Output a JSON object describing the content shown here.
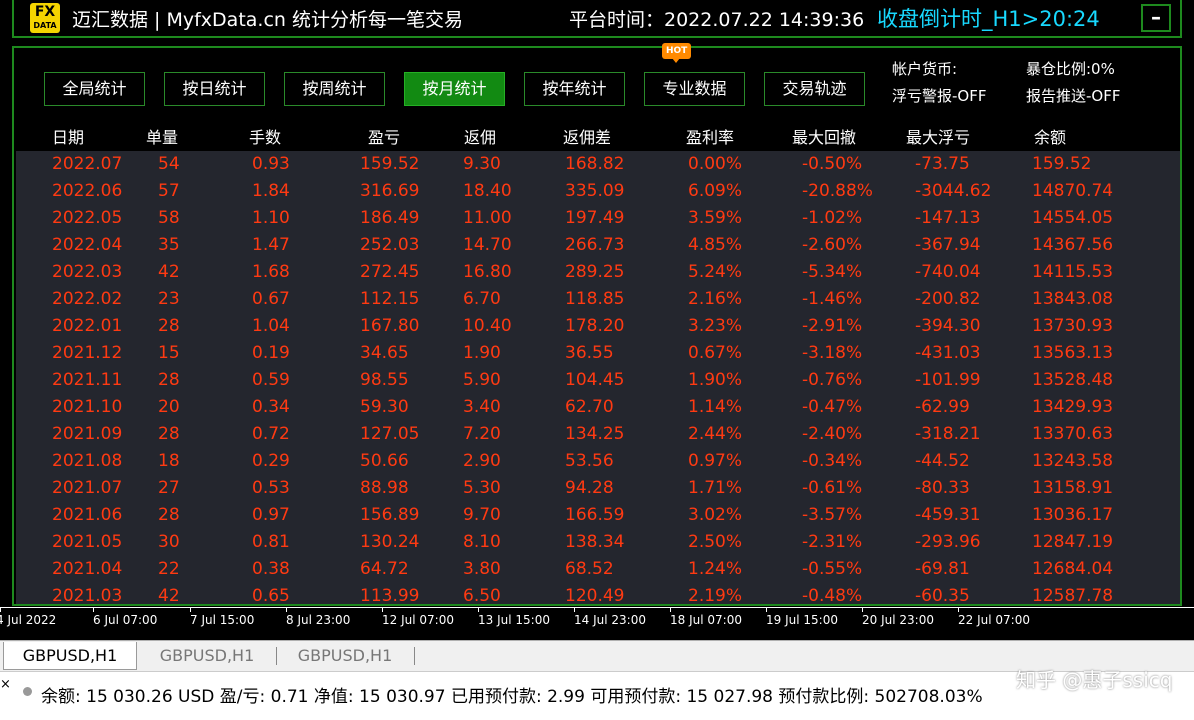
{
  "titlebar": {
    "logo_top": "FX",
    "logo_bottom": "DATA",
    "app_title": "迈汇数据 | MyfxData.cn  统计分析每一笔交易",
    "platform_time": "平台时间：2022.07.22 14:39:36",
    "countdown": "收盘倒计时_H1>20:24",
    "minimize_label": "–"
  },
  "nav": {
    "buttons": [
      "全局统计",
      "按日统计",
      "按周统计",
      "按月统计",
      "按年统计",
      "专业数据",
      "交易轨迹"
    ],
    "active": "按月统计",
    "hot_badge": "HOT"
  },
  "info": {
    "account_currency": "帐户货币:",
    "exposure": "暴仓比例:0%",
    "float_alert": "浮亏警报-OFF",
    "report_push": "报告推送-OFF"
  },
  "table": {
    "headers": [
      "日期",
      "单量",
      "手数",
      "盈亏",
      "返佣",
      "返佣差",
      "盈利率",
      "最大回撤",
      "最大浮亏",
      "余额"
    ],
    "rows": [
      [
        "2022.07",
        "54",
        "0.93",
        "159.52",
        "9.30",
        "168.82",
        "0.00%",
        "-0.50%",
        "-73.75",
        "159.52"
      ],
      [
        "2022.06",
        "57",
        "1.84",
        "316.69",
        "18.40",
        "335.09",
        "6.09%",
        "-20.88%",
        "-3044.62",
        "14870.74"
      ],
      [
        "2022.05",
        "58",
        "1.10",
        "186.49",
        "11.00",
        "197.49",
        "3.59%",
        "-1.02%",
        "-147.13",
        "14554.05"
      ],
      [
        "2022.04",
        "35",
        "1.47",
        "252.03",
        "14.70",
        "266.73",
        "4.85%",
        "-2.60%",
        "-367.94",
        "14367.56"
      ],
      [
        "2022.03",
        "42",
        "1.68",
        "272.45",
        "16.80",
        "289.25",
        "5.24%",
        "-5.34%",
        "-740.04",
        "14115.53"
      ],
      [
        "2022.02",
        "23",
        "0.67",
        "112.15",
        "6.70",
        "118.85",
        "2.16%",
        "-1.46%",
        "-200.82",
        "13843.08"
      ],
      [
        "2022.01",
        "28",
        "1.04",
        "167.80",
        "10.40",
        "178.20",
        "3.23%",
        "-2.91%",
        "-394.30",
        "13730.93"
      ],
      [
        "2021.12",
        "15",
        "0.19",
        "34.65",
        "1.90",
        "36.55",
        "0.67%",
        "-3.18%",
        "-431.03",
        "13563.13"
      ],
      [
        "2021.11",
        "28",
        "0.59",
        "98.55",
        "5.90",
        "104.45",
        "1.90%",
        "-0.76%",
        "-101.99",
        "13528.48"
      ],
      [
        "2021.10",
        "20",
        "0.34",
        "59.30",
        "3.40",
        "62.70",
        "1.14%",
        "-0.47%",
        "-62.99",
        "13429.93"
      ],
      [
        "2021.09",
        "28",
        "0.72",
        "127.05",
        "7.20",
        "134.25",
        "2.44%",
        "-2.40%",
        "-318.21",
        "13370.63"
      ],
      [
        "2021.08",
        "18",
        "0.29",
        "50.66",
        "2.90",
        "53.56",
        "0.97%",
        "-0.34%",
        "-44.52",
        "13243.58"
      ],
      [
        "2021.07",
        "27",
        "0.53",
        "88.98",
        "5.30",
        "94.28",
        "1.71%",
        "-0.61%",
        "-80.33",
        "13158.91"
      ],
      [
        "2021.06",
        "28",
        "0.97",
        "156.89",
        "9.70",
        "166.59",
        "3.02%",
        "-3.57%",
        "-459.31",
        "13036.17"
      ],
      [
        "2021.05",
        "30",
        "0.81",
        "130.24",
        "8.10",
        "138.34",
        "2.50%",
        "-2.31%",
        "-293.96",
        "12847.19"
      ],
      [
        "2021.04",
        "22",
        "0.38",
        "64.72",
        "3.80",
        "68.52",
        "1.24%",
        "-0.55%",
        "-69.81",
        "12684.04"
      ],
      [
        "2021.03",
        "42",
        "0.65",
        "113.99",
        "6.50",
        "120.49",
        "2.19%",
        "-0.48%",
        "-60.35",
        "12587.78"
      ]
    ]
  },
  "time_axis": [
    "4 Jul 2022",
    "6 Jul 07:00",
    "7 Jul 15:00",
    "8 Jul 23:00",
    "12 Jul 07:00",
    "13 Jul 15:00",
    "14 Jul 23:00",
    "18 Jul 07:00",
    "19 Jul 15:00",
    "20 Jul 23:00",
    "22 Jul 07:00"
  ],
  "tabs": [
    "GBPUSD,H1",
    "GBPUSD,H1",
    "GBPUSD,H1"
  ],
  "statusbar": {
    "close_label": "×",
    "text": "余额: 15 030.26 USD  盈/亏: 0.71  净值: 15 030.97  已用预付款: 2.99  可用预付款: 15 027.98  预付款比例: 502708.03%"
  },
  "watermark": "知乎 @惠子ssicq",
  "colors": {
    "border_green": "#1e8a1e",
    "active_green": "#128a12",
    "countdown_cyan": "#18d9ff",
    "data_red": "#ff3a12",
    "table_bg": "#24262e",
    "hot_orange": "#ff8a00",
    "logo_yellow": "#f5d400"
  }
}
